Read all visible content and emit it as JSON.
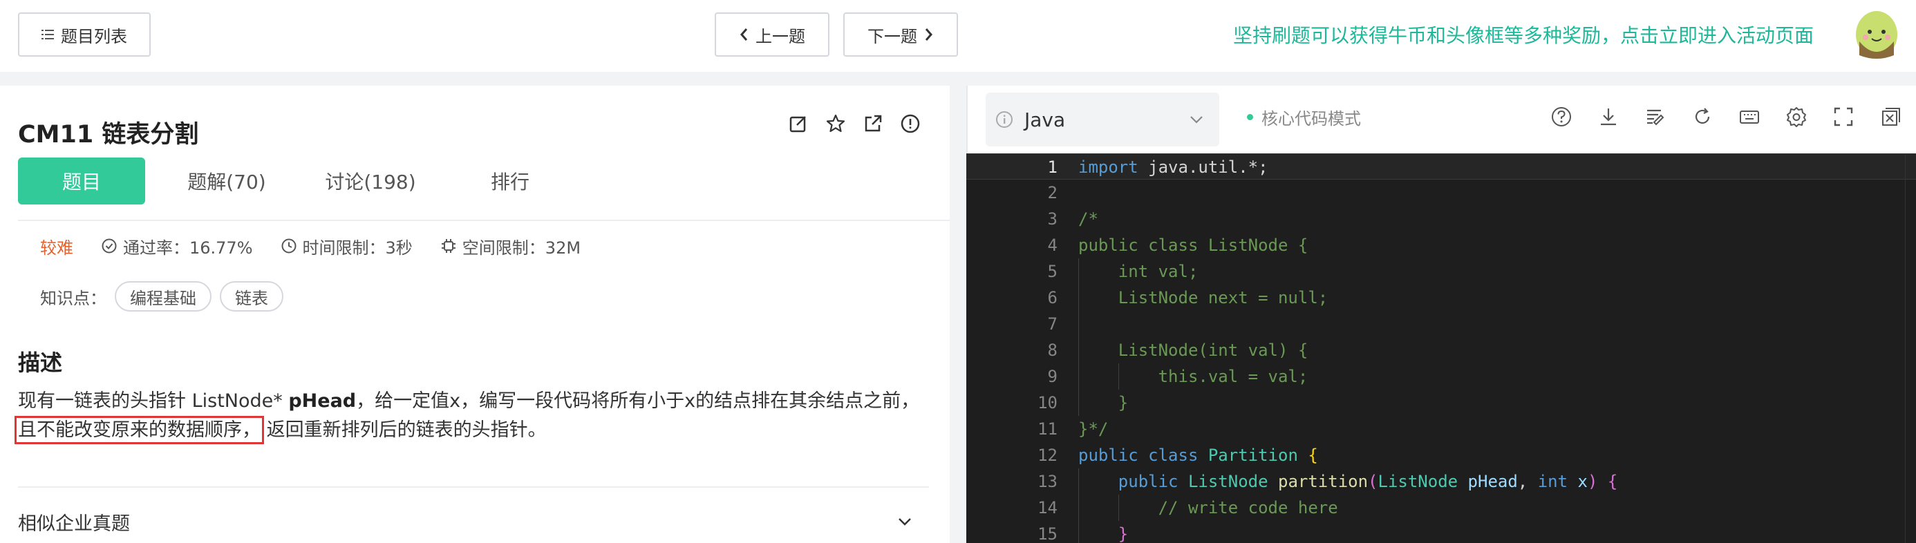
{
  "topbar": {
    "list_label": "题目列表",
    "prev_label": "上一题",
    "next_label": "下一题",
    "promo": "坚持刷题可以获得牛币和头像框等多种奖励，点击立即进入活动页面"
  },
  "problem": {
    "title": "CM11  链表分割",
    "tabs": [
      "题目",
      "题解(70)",
      "讨论(198)",
      "排行"
    ],
    "difficulty": "较难",
    "pass_rate": "通过率：16.77%",
    "time_limit": "时间限制：3秒",
    "space_limit": "空间限制：32M",
    "knowledge_label": "知识点：",
    "knowledge_tags": [
      "编程基础",
      "链表"
    ],
    "desc_heading": "描述",
    "desc_part1": "现有一链表的头指针 ListNode* ",
    "desc_bold": "pHead",
    "desc_part2": "，给一定值x，编写一段代码将所有小于x的结点排在其余结点之前，",
    "desc_highlight": "且不能改变原来的数据顺序，",
    "desc_part3": "返回重新排列后的链表的头指针。",
    "similar_label": "相似企业真题"
  },
  "editor": {
    "language": "Java",
    "mode": "核心代码模式",
    "line_numbers": [
      "1",
      "2",
      "3",
      "4",
      "5",
      "6",
      "7",
      "8",
      "9",
      "10",
      "11",
      "12",
      "13",
      "14",
      "15"
    ],
    "code": {
      "l1_kw": "import",
      "l1_rest": " java.util.*;",
      "l3": "/*",
      "l4": "public class ListNode {",
      "l5": "    int val;",
      "l6": "    ListNode next = null;",
      "l8": "    ListNode(int val) {",
      "l9": "        this.val = val;",
      "l10": "    }",
      "l11": "}*/",
      "l12_public": "public",
      "l12_class": "class",
      "l12_name": "Partition",
      "l12_brace": "{",
      "l13_public": "public",
      "l13_type": "ListNode",
      "l13_fn": "partition",
      "l13_open": "(",
      "l13_ptype": "ListNode",
      "l13_p1": "pHead",
      "l13_comma": ", ",
      "l13_int": "int",
      "l13_p2": "x",
      "l13_close": ")",
      "l13_brace": "{",
      "l14": "// write code here",
      "l15": "}"
    }
  },
  "colors": {
    "accent": "#32ca99",
    "promo": "#1db89a",
    "difficulty": "#e8612c",
    "highlight_box": "#e03535",
    "editor_bg": "#1e1e1e"
  }
}
